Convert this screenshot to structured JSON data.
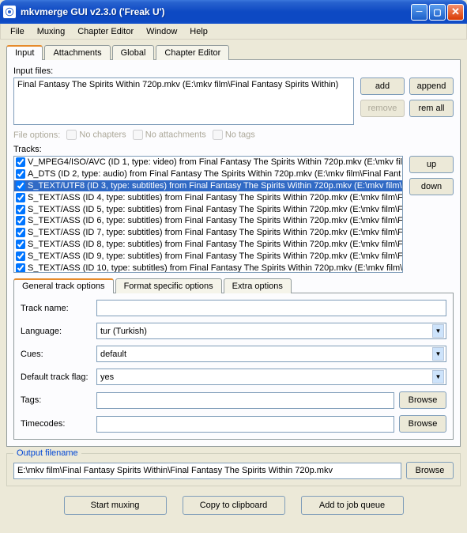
{
  "window": {
    "title": "mkvmerge GUI v2.3.0 ('Freak U')"
  },
  "menu": {
    "file": "File",
    "muxing": "Muxing",
    "chapter_editor": "Chapter Editor",
    "window": "Window",
    "help": "Help"
  },
  "main_tabs": {
    "input": "Input",
    "attachments": "Attachments",
    "global": "Global",
    "chapter_editor": "Chapter Editor"
  },
  "input": {
    "files_label": "Input files:",
    "file": "Final Fantasy The Spirits Within 720p.mkv (E:\\mkv film\\Final Fantasy Spirits Within)",
    "btn_add": "add",
    "btn_append": "append",
    "btn_remove": "remove",
    "btn_remall": "rem all",
    "fileopts_label": "File options:",
    "no_chapters": "No chapters",
    "no_attachments": "No attachments",
    "no_tags": "No tags",
    "tracks_label": "Tracks:",
    "tracks": [
      "V_MPEG4/ISO/AVC (ID 1, type: video) from Final Fantasy The Spirits Within 720p.mkv (E:\\mkv fil",
      "A_DTS (ID 2, type: audio) from Final Fantasy The Spirits Within 720p.mkv (E:\\mkv film\\Final Fant",
      "S_TEXT/UTF8 (ID 3, type: subtitles) from Final Fantasy The Spirits Within 720p.mkv (E:\\mkv film\\",
      "S_TEXT/ASS (ID 4, type: subtitles) from Final Fantasy The Spirits Within 720p.mkv (E:\\mkv film\\F",
      "S_TEXT/ASS (ID 5, type: subtitles) from Final Fantasy The Spirits Within 720p.mkv (E:\\mkv film\\F",
      "S_TEXT/ASS (ID 6, type: subtitles) from Final Fantasy The Spirits Within 720p.mkv (E:\\mkv film\\F",
      "S_TEXT/ASS (ID 7, type: subtitles) from Final Fantasy The Spirits Within 720p.mkv (E:\\mkv film\\F",
      "S_TEXT/ASS (ID 8, type: subtitles) from Final Fantasy The Spirits Within 720p.mkv (E:\\mkv film\\F",
      "S_TEXT/ASS (ID 9, type: subtitles) from Final Fantasy The Spirits Within 720p.mkv (E:\\mkv film\\F",
      "S_TEXT/ASS (ID 10, type: subtitles) from Final Fantasy The Spirits Within 720p.mkv (E:\\mkv film\\"
    ],
    "selected_track": 2,
    "btn_up": "up",
    "btn_down": "down"
  },
  "track_tabs": {
    "general": "General track options",
    "format": "Format specific options",
    "extra": "Extra options"
  },
  "track_opts": {
    "track_name_label": "Track name:",
    "track_name": "",
    "language_label": "Language:",
    "language": "tur (Turkish)",
    "cues_label": "Cues:",
    "cues": "default",
    "default_flag_label": "Default track flag:",
    "default_flag": "yes",
    "tags_label": "Tags:",
    "tags": "",
    "timecodes_label": "Timecodes:",
    "timecodes": "",
    "browse": "Browse"
  },
  "output": {
    "legend": "Output filename",
    "path": "E:\\mkv film\\Final Fantasy Spirits Within\\Final Fantasy The Spirits Within 720p.mkv",
    "browse": "Browse"
  },
  "bottom": {
    "start": "Start muxing",
    "copy": "Copy to clipboard",
    "add_queue": "Add to job queue"
  }
}
